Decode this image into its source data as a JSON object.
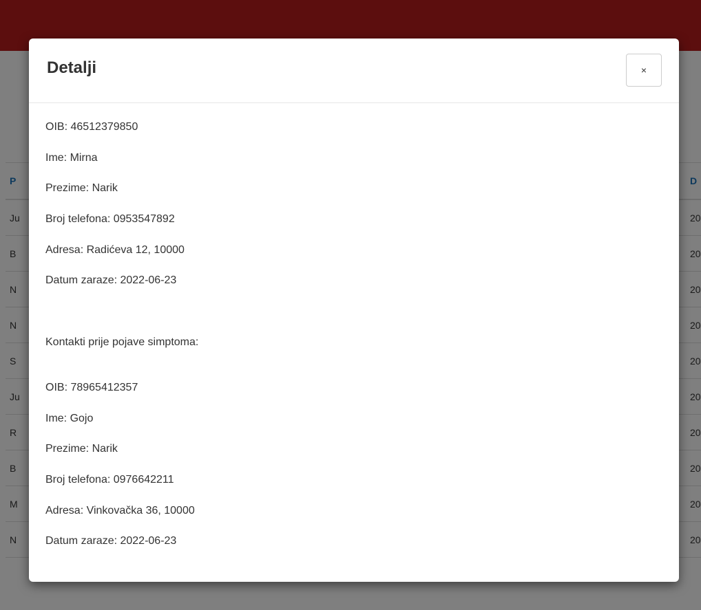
{
  "modal": {
    "title": "Detalji",
    "close_label": "×",
    "person": [
      "OIB: 46512379850",
      "Ime: Mirna",
      "Prezime: Narik",
      "Broj telefona: 0953547892",
      "Adresa: Radićeva 12, 10000",
      "Datum zaraze: 2022-06-23"
    ],
    "contacts_label": "Kontakti prije pojave simptoma:",
    "contact": [
      "OIB: 78965412357",
      "Ime: Gojo",
      "Prezime: Narik",
      "Broj telefona: 0976642211",
      "Adresa: Vinkovačka 36, 10000",
      "Datum zaraze: 2022-06-23"
    ]
  },
  "background_table": {
    "header_left": "P",
    "header_right": "D",
    "rows": [
      {
        "left": "Ju",
        "right": "20"
      },
      {
        "left": "B",
        "right": "20"
      },
      {
        "left": "N",
        "right": "20"
      },
      {
        "left": "N",
        "right": "20"
      },
      {
        "left": "S",
        "right": "20"
      },
      {
        "left": "Ju",
        "right": "20"
      },
      {
        "left": "R",
        "right": "20"
      },
      {
        "left": "B",
        "right": "20"
      },
      {
        "left": "M",
        "right": "20"
      },
      {
        "left": "N",
        "right": "20"
      }
    ]
  },
  "colors": {
    "top_bar": "#b81c1c",
    "header_text": "#1a73b8"
  }
}
